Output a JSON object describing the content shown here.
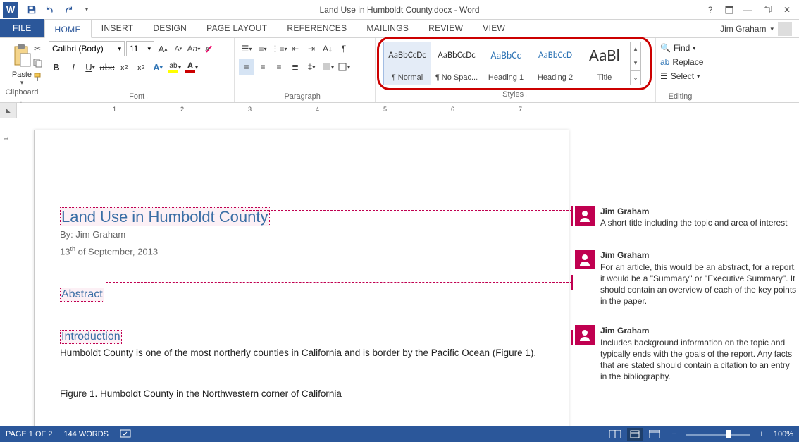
{
  "title": "Land Use in Humboldt County.docx - Word",
  "user": "Jim Graham",
  "tabs": {
    "file": "FILE",
    "home": "HOME",
    "insert": "INSERT",
    "design": "DESIGN",
    "layout": "PAGE LAYOUT",
    "refs": "REFERENCES",
    "mail": "MAILINGS",
    "review": "REVIEW",
    "view": "VIEW"
  },
  "clipboard": {
    "paste": "Paste",
    "label": "Clipboard"
  },
  "font": {
    "name": "Calibri (Body)",
    "size": "11",
    "label": "Font"
  },
  "paragraph": {
    "label": "Paragraph"
  },
  "styles": {
    "label": "Styles",
    "items": [
      {
        "preview": "AaBbCcDc",
        "name": "¶ Normal",
        "cls": "",
        "sel": true
      },
      {
        "preview": "AaBbCcDc",
        "name": "¶ No Spac...",
        "cls": ""
      },
      {
        "preview": "AaBbCc",
        "name": "Heading 1",
        "cls": "h1"
      },
      {
        "preview": "AaBbCcD",
        "name": "Heading 2",
        "cls": "h2"
      },
      {
        "preview": "AaBl",
        "name": "Title",
        "cls": "title"
      }
    ]
  },
  "editing": {
    "find": "Find",
    "replace": "Replace",
    "select": "Select",
    "label": "Editing"
  },
  "doc": {
    "title": "Land Use in Humboldt County",
    "byline": "By: Jim Graham",
    "date_pre": "13",
    "date_sup": "th",
    "date_post": " of September, 2013",
    "abstract": "Abstract",
    "intro": "Introduction",
    "body": "Humboldt County is one of the most northerly counties in California and is border by the Pacific Ocean (Figure 1).",
    "figure": "Figure 1. Humboldt County in the Northwestern corner of California"
  },
  "comments": [
    {
      "author": "Jim Graham",
      "text": "A short title including the topic and area of interest"
    },
    {
      "author": "Jim Graham",
      "text": "For an article, this would be an abstract, for a report, it would be a \"Summary\" or \"Executive Summary\".  It should contain an overview of each of the key points in the paper."
    },
    {
      "author": "Jim Graham",
      "text": "Includes background information on the topic and typically ends with the goals of the report.  Any facts that are stated should contain a citation to an entry in the bibliography."
    }
  ],
  "status": {
    "page": "PAGE 1 OF 2",
    "words": "144 WORDS",
    "zoom": "100%"
  },
  "ruler": {
    "n1": "1",
    "n2": "2",
    "n3": "3",
    "n4": "4",
    "n5": "5",
    "n6": "6",
    "n7": "7"
  }
}
